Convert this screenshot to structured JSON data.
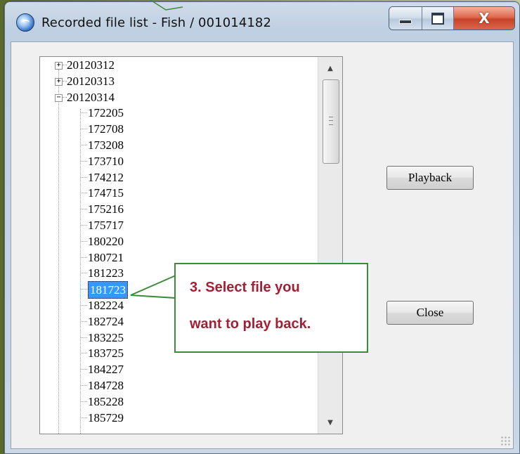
{
  "window": {
    "title": "Recorded file list - Fish / 001014182",
    "controls": {
      "minimize": "–",
      "maximize": "□",
      "close": "X"
    }
  },
  "tree": {
    "items": [
      {
        "label": "20120312",
        "level": 0,
        "expander": "+"
      },
      {
        "label": "20120313",
        "level": 0,
        "expander": "+"
      },
      {
        "label": "20120314",
        "level": 0,
        "expander": "−"
      },
      {
        "label": "172205",
        "level": 1
      },
      {
        "label": "172708",
        "level": 1
      },
      {
        "label": "173208",
        "level": 1
      },
      {
        "label": "173710",
        "level": 1
      },
      {
        "label": "174212",
        "level": 1
      },
      {
        "label": "174715",
        "level": 1
      },
      {
        "label": "175216",
        "level": 1
      },
      {
        "label": "175717",
        "level": 1
      },
      {
        "label": "180220",
        "level": 1
      },
      {
        "label": "180721",
        "level": 1
      },
      {
        "label": "181223",
        "level": 1
      },
      {
        "label": "181723",
        "level": 1,
        "selected": true
      },
      {
        "label": "182224",
        "level": 1
      },
      {
        "label": "182724",
        "level": 1
      },
      {
        "label": "183225",
        "level": 1
      },
      {
        "label": "183725",
        "level": 1
      },
      {
        "label": "184227",
        "level": 1
      },
      {
        "label": "184728",
        "level": 1
      },
      {
        "label": "185228",
        "level": 1
      },
      {
        "label": "185729",
        "level": 1
      }
    ]
  },
  "buttons": {
    "playback": "Playback",
    "close": "Close"
  },
  "callout": {
    "line1": "3. Select file you",
    "line2": "want to play back."
  },
  "colors": {
    "selection": "#3399ff",
    "callout_border": "#3d8b3a",
    "callout_text": "#a41e34"
  }
}
